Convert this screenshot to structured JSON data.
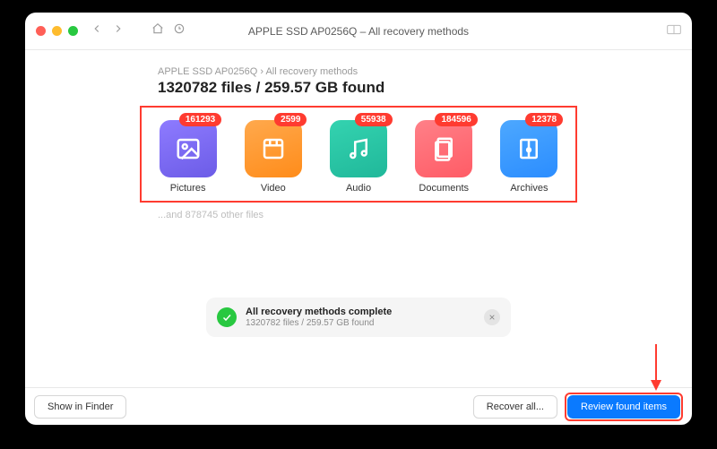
{
  "window": {
    "title": "APPLE SSD AP0256Q – All recovery methods",
    "breadcrumb": "APPLE SSD AP0256Q › All recovery methods",
    "headline": "1320782 files / 259.57 GB found"
  },
  "categories": [
    {
      "name": "Pictures",
      "count": "161293",
      "color": "g-purple",
      "icon": "image"
    },
    {
      "name": "Video",
      "count": "2599",
      "color": "g-orange",
      "icon": "film"
    },
    {
      "name": "Audio",
      "count": "55938",
      "color": "g-teal",
      "icon": "music"
    },
    {
      "name": "Documents",
      "count": "184596",
      "color": "g-pink",
      "icon": "doc"
    },
    {
      "name": "Archives",
      "count": "12378",
      "color": "g-blue",
      "icon": "archive"
    }
  ],
  "other_files": "...and 878745 other files",
  "status": {
    "title": "All recovery methods complete",
    "subtitle": "1320782 files / 259.57 GB found"
  },
  "footer": {
    "show_in_finder": "Show in Finder",
    "recover_all": "Recover all...",
    "review": "Review found items"
  }
}
